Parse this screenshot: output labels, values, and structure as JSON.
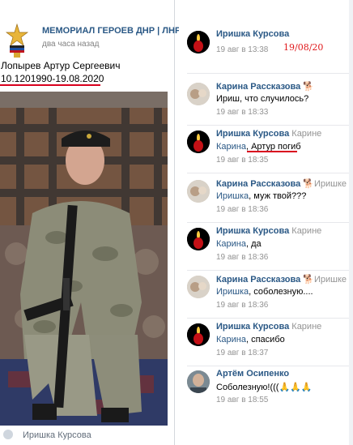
{
  "post": {
    "group_name": "МЕМОРИАЛ ГЕРОЕВ ДНР | ЛНР",
    "time": "два часа назад",
    "text_line1": "Лопырев Артур Сергеевич",
    "text_line2": "10.1201990-19.08.2020",
    "author_footer": "Иришка Курсова",
    "underline_color": "#d9001e"
  },
  "comments": [
    {
      "author": "Иришка Курсова",
      "reply_to": "",
      "text": "",
      "link": "",
      "date": "19 авг в 13:38",
      "avatar": "candle-icon"
    },
    {
      "author": "Карина Рассказова",
      "reply_to": "",
      "text": "Ириш, что случилось?",
      "link": "",
      "date": "19 авг в 18:33",
      "avatar": "user-photo"
    },
    {
      "author": "Иришка Курсова",
      "reply_to": "Карине",
      "text": ", Артур погиб",
      "link": "Карина",
      "date": "19 авг в 18:35",
      "avatar": "candle-icon"
    },
    {
      "author": "Карина Рассказова",
      "reply_to": "Иришке",
      "text": ", муж твой???",
      "link": "Иришка",
      "date": "19 авг в 18:36",
      "avatar": "user-photo"
    },
    {
      "author": "Иришка Курсова",
      "reply_to": "Карине",
      "text": ", да",
      "link": "Карина",
      "date": "19 авг в 18:36",
      "avatar": "candle-icon"
    },
    {
      "author": "Карина Рассказова",
      "reply_to": "Иришке",
      "text": ", соболезную....",
      "link": "Иришка",
      "date": "19 авг в 18:36",
      "avatar": "user-photo"
    },
    {
      "author": "Иришка Курсова",
      "reply_to": "Карине",
      "text": ", спасибо",
      "link": "Карина",
      "date": "19 авг в 18:37",
      "avatar": "candle-icon"
    },
    {
      "author": "Артём Осипенко",
      "reply_to": "",
      "text": "Соболезную!(((",
      "link": "",
      "date": "19 авг в 18:55",
      "avatar": "user-photo"
    }
  ],
  "handwritten_note": "19/08/20",
  "emoji_hands": "🙏🙏🙏",
  "dog_emoji": "🐕",
  "colors": {
    "link": "#2a5885",
    "muted": "#939393",
    "annotation": "#e0181b"
  }
}
